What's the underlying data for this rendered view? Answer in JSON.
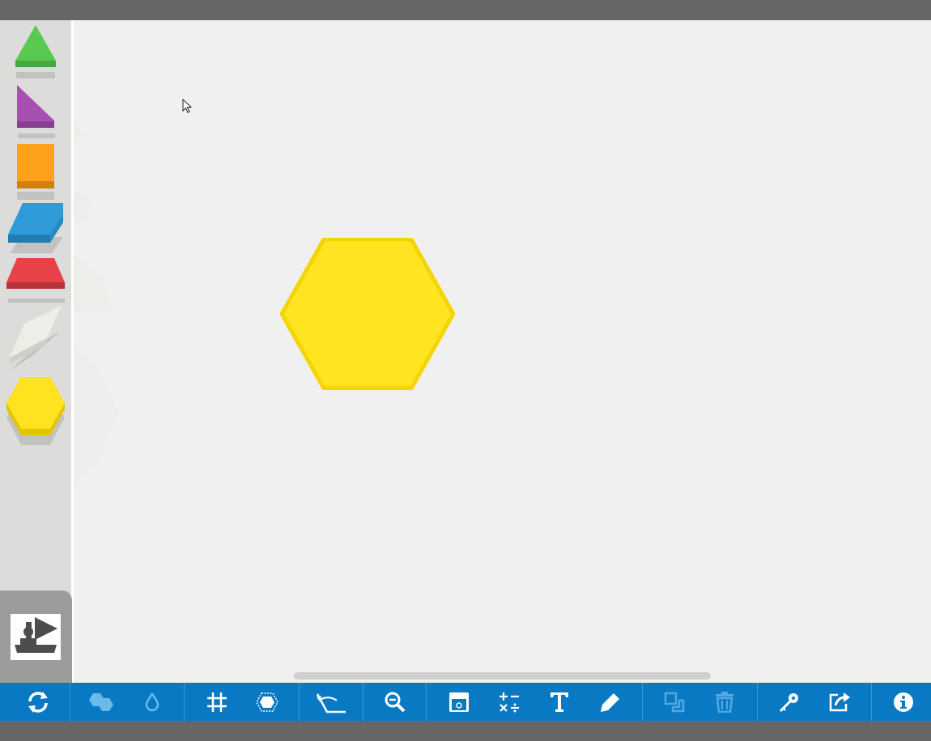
{
  "app": {
    "colors": {
      "toolbar": "#0a79c3",
      "sidebar": "#dcdcdb",
      "workspace": "#f0f0f0",
      "frame": "#666666"
    }
  },
  "sidebar": {
    "shapes": [
      {
        "id": "triangle",
        "icon": "green-triangle-icon",
        "color": "#5ac94f"
      },
      {
        "id": "right-triangle",
        "icon": "purple-triangle-icon",
        "color": "#a84fb4"
      },
      {
        "id": "square",
        "icon": "orange-square-icon",
        "color": "#ffa11a"
      },
      {
        "id": "rhombus",
        "icon": "blue-rhombus-icon",
        "color": "#2e9bd8"
      },
      {
        "id": "trapezoid",
        "icon": "red-trapezoid-icon",
        "color": "#e9434a"
      },
      {
        "id": "thin-rhombus",
        "icon": "tan-rhombus-icon",
        "color": "#eeeee8"
      },
      {
        "id": "hexagon",
        "icon": "yellow-hexagon-icon",
        "color": "#ffe220"
      }
    ],
    "stamp": {
      "icon": "stamp-tool-icon"
    }
  },
  "workspace": {
    "pieces": [
      {
        "shape": "hexagon",
        "color": "#ffe421",
        "stroke": "#f5d400"
      }
    ]
  },
  "toolbar": {
    "tools": [
      {
        "name": "reset",
        "icon": "refresh-icon",
        "enabled": true
      },
      {
        "name": "shapes-set",
        "icon": "hexagons-icon",
        "enabled": true
      },
      {
        "name": "fill-color",
        "icon": "droplet-icon",
        "enabled": true
      },
      {
        "name": "grid",
        "icon": "grid-icon",
        "enabled": true
      },
      {
        "name": "outline",
        "icon": "hexagon-outline-icon",
        "enabled": true
      },
      {
        "name": "angles",
        "icon": "angle-icon",
        "enabled": true
      },
      {
        "name": "zoom-out",
        "icon": "zoom-out-icon",
        "enabled": true
      },
      {
        "name": "background",
        "icon": "window-icon",
        "enabled": true
      },
      {
        "name": "math",
        "icon": "operators-icon",
        "enabled": true
      },
      {
        "name": "text",
        "icon": "text-icon",
        "enabled": true
      },
      {
        "name": "draw",
        "icon": "pencil-icon",
        "enabled": true
      },
      {
        "name": "duplicate",
        "icon": "duplicate-icon",
        "enabled": false
      },
      {
        "name": "delete",
        "icon": "trash-icon",
        "enabled": false
      },
      {
        "name": "key",
        "icon": "key-icon",
        "enabled": true
      },
      {
        "name": "share",
        "icon": "share-icon",
        "enabled": true
      },
      {
        "name": "info",
        "icon": "info-icon",
        "enabled": true
      }
    ]
  }
}
